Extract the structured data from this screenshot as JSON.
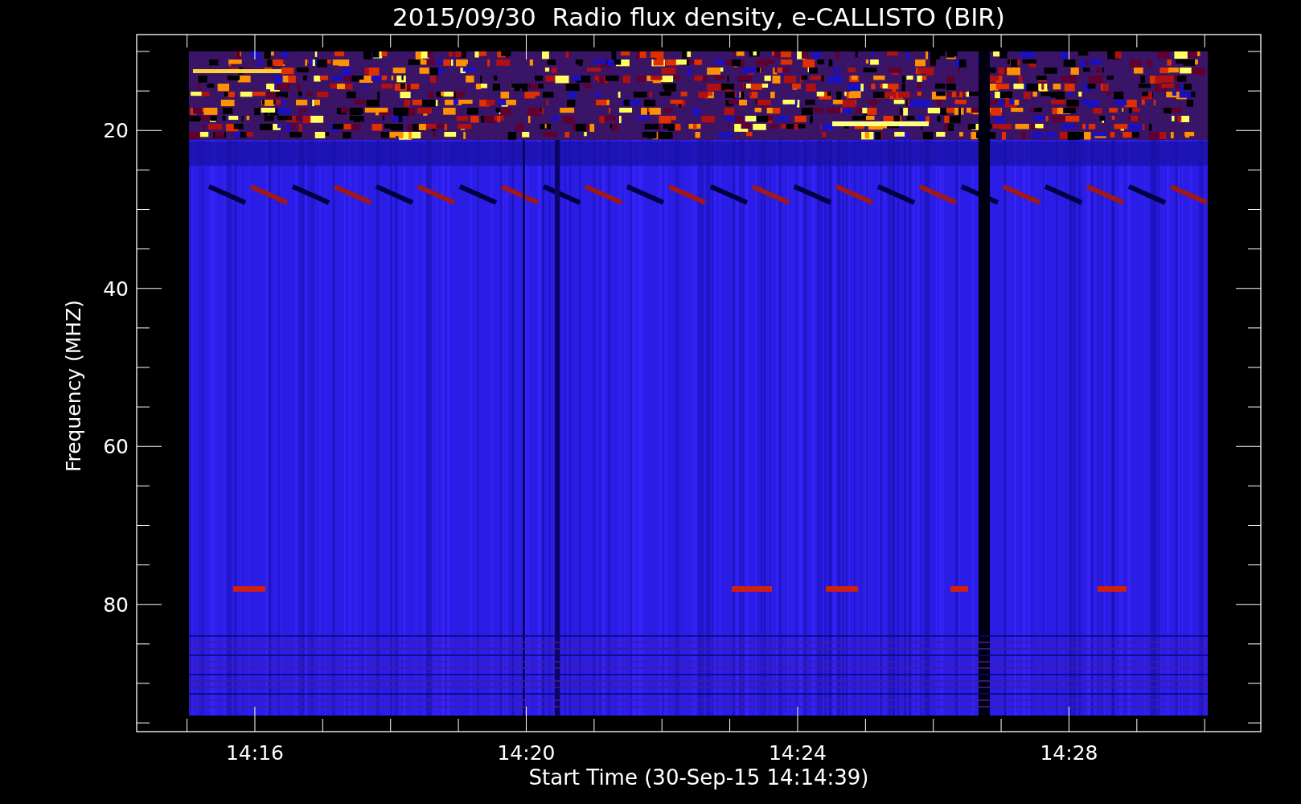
{
  "title": "2015/09/30  Radio flux density, e-CALLISTO (BIR)",
  "plot": {
    "kind": "spectrogram"
  },
  "y_axis": {
    "label": "Frequency (MHZ)",
    "tick_labels": [
      "20",
      "40",
      "60",
      "80"
    ]
  },
  "x_axis": {
    "label": "Start Time (30-Sep-15 14:14:39)",
    "tick_labels": [
      "14:16",
      "14:20",
      "14:24",
      "14:28"
    ]
  }
}
